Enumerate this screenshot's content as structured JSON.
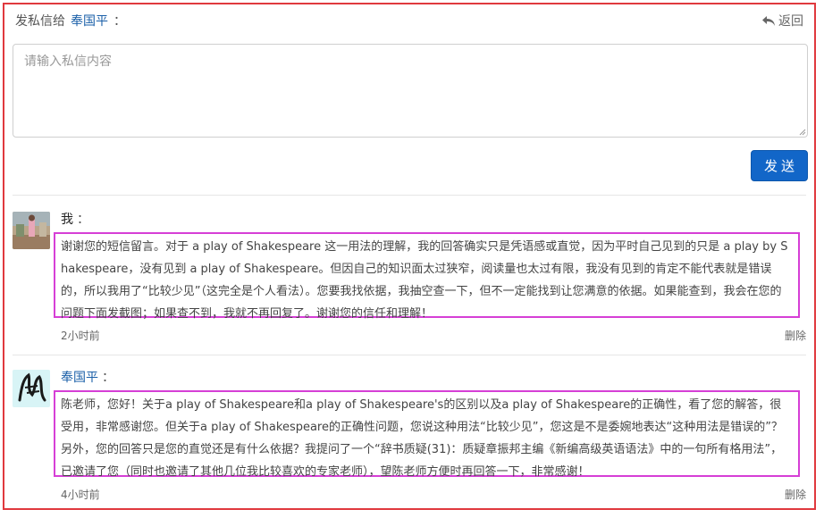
{
  "header": {
    "prefix": "发私信给",
    "recipient": "奉国平",
    "colon": "：",
    "back_label": "返回"
  },
  "compose": {
    "placeholder": "请输入私信内容",
    "value": "",
    "send_label": "发送"
  },
  "messages": [
    {
      "sender": "我",
      "colon": "：",
      "text": "谢谢您的短信留言。对于 a play of Shakespeare 这一用法的理解，我的回答确实只是凭语感或直觉，因为平时自己见到的只是 a play by Shakespeare，没有见到 a play of Shakespeare。但因自己的知识面太过狭窄，阅读量也太过有限，我没有见到的肯定不能代表就是错误的，所以我用了“比较少见”（这完全是个人看法）。您要我找依据，我抽空查一下，但不一定能找到让您满意的依据。如果能查到，我会在您的问题下面发截图；如果查不到，我就不再回复了。谢谢您的信任和理解！",
      "time": "2小时前",
      "delete_label": "删除"
    },
    {
      "sender": "奉国平",
      "colon": "：",
      "text": "陈老师，您好！关于a play of Shakespeare和a play of Shakespeare's的区别以及a play of Shakespeare的正确性，看了您的解答，很受用，非常感谢您。但关于a play of Shakespeare的正确性问题，您说这种用法“比较少见”，您这是不是委婉地表达“这种用法是错误的”？另外，您的回答只是您的直觉还是有什么依据？我提问了一个“辞书质疑(31)：质疑章振邦主编《新编高级英语语法》中的一句所有格用法”，已邀请了您（同时也邀请了其他几位我比较喜欢的专家老师），望陈老师方便时再回答一下，非常感谢！",
      "time": "4小时前",
      "delete_label": "删除"
    }
  ],
  "colors": {
    "frame_border": "#e0393e",
    "highlight_border": "#d63fd6",
    "link_blue": "#1a5fa8",
    "send_button": "#1266c8"
  }
}
